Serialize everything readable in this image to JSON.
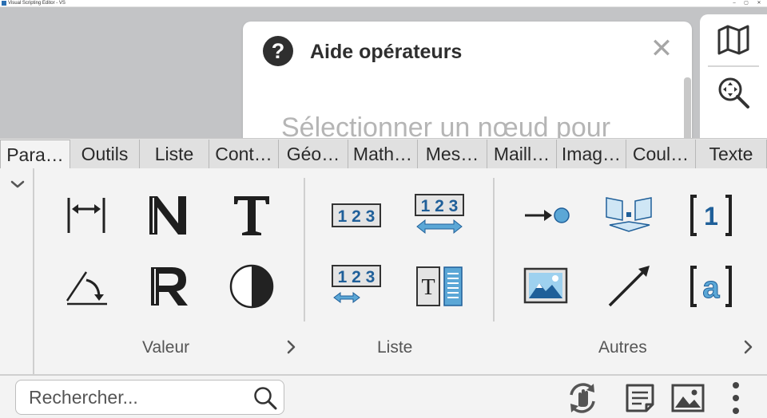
{
  "window": {
    "title": "Visual Scripting Editor - VS",
    "controls": [
      "–",
      "▢",
      "✕"
    ]
  },
  "help_panel": {
    "icon": "question-circle-icon",
    "title": "Aide opérateurs",
    "close_label": "✕",
    "body": "Sélectionner un nœud pour"
  },
  "right_tools": [
    "map-icon",
    "zoom-fit-icon"
  ],
  "tabs": [
    {
      "label": "Para…",
      "active": true
    },
    {
      "label": "Outils"
    },
    {
      "label": "Liste"
    },
    {
      "label": "Cont…"
    },
    {
      "label": "Géo…"
    },
    {
      "label": "Math…"
    },
    {
      "label": "Mes…"
    },
    {
      "label": "Maill…"
    },
    {
      "label": "Imag…"
    },
    {
      "label": "Coul…"
    },
    {
      "label": "Texte"
    }
  ],
  "sections": {
    "valeur": {
      "label": "Valeur",
      "icons": [
        "distance-icon",
        "integer-icon",
        "text-icon",
        "angle-icon",
        "real-number-icon",
        "contrast-icon"
      ]
    },
    "liste": {
      "label": "Liste",
      "icons": [
        "number-list-icon",
        "number-list-range-icon",
        "number-list-small-range-icon",
        "text-list-icon"
      ]
    },
    "autres": {
      "label": "Autres",
      "icons": [
        "arrow-to-point-icon",
        "plane-projection-icon",
        "index-bracket-icon",
        "image-icon",
        "vector-arrow-icon",
        "letter-bracket-icon"
      ]
    }
  },
  "search": {
    "placeholder": "Rechercher..."
  },
  "bottom_actions": [
    "refresh-hand-icon",
    "notes-icon",
    "picture-icon",
    "more-vertical-icon"
  ],
  "colors": {
    "accent": "#1f6aa5",
    "accent_light": "#5ba7d6",
    "panel": "#f3f3f3",
    "canvas": "#c3c4c6"
  }
}
